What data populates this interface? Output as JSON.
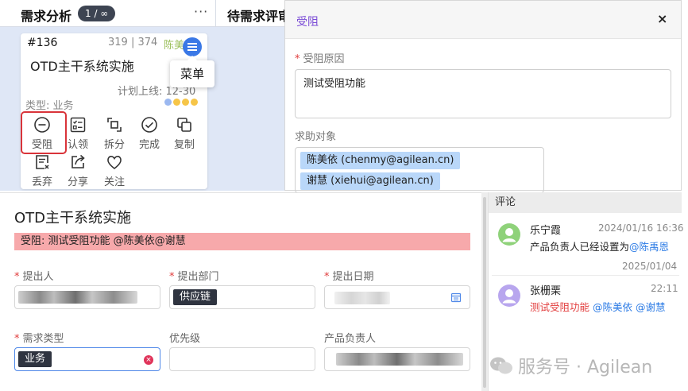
{
  "kanban": {
    "column1_title": "需求分析",
    "column1_count": "1 / ∞",
    "column2_title": "待需求评审",
    "card": {
      "id": "#136",
      "nums": "319 | 374",
      "owner": "陈美",
      "title": "OTD主干系统实施",
      "plan": "计划上线: 12-30",
      "type": "类型: 业务",
      "dot_colors": [
        "#9bb8f0",
        "#f6c548",
        "#f6c548",
        "#f6c548"
      ]
    },
    "menu_tooltip": "菜单",
    "actions": [
      {
        "label": "受阻",
        "icon": "minus-circle-icon"
      },
      {
        "label": "认领",
        "icon": "checklist-icon"
      },
      {
        "label": "拆分",
        "icon": "split-icon"
      },
      {
        "label": "完成",
        "icon": "check-circle-icon"
      },
      {
        "label": "复制",
        "icon": "copy-icon"
      },
      {
        "label": "丢弃",
        "icon": "discard-icon"
      },
      {
        "label": "分享",
        "icon": "share-icon"
      },
      {
        "label": "关注",
        "icon": "heart-icon"
      }
    ]
  },
  "dialog": {
    "title": "受阻",
    "close": "×",
    "reason_label": "受阻原因",
    "reason_value": "测试受阻功能",
    "helpers_label": "求助对象",
    "helpers": [
      "陈美依 (chenmy@agilean.cn)",
      "谢慧 (xiehui@agilean.cn)"
    ]
  },
  "detail": {
    "title": "OTD主干系统实施",
    "banner": "受阻: 测试受阻功能 @陈美依@谢慧",
    "fields": {
      "proposer_label": "提出人",
      "dept_label": "提出部门",
      "dept_value": "供应链",
      "date_label": "提出日期",
      "type_label": "需求类型",
      "type_value": "业务",
      "priority_label": "优先级",
      "owner_label": "产品负责人"
    }
  },
  "comments": {
    "header": "评论",
    "items": [
      {
        "name": "乐宁霞",
        "time": "2024/01/16 16:36",
        "text": "产品负责人已经设置为",
        "mention": "@陈禹恩",
        "avatar_color": "#8fd27a"
      },
      {
        "name": "张栅栗",
        "time": "22:11",
        "text": "测试受阻功能",
        "mention": "@陈美依 @谢慧",
        "avatar_color": "#b8a6ee"
      }
    ],
    "date_separator": "2025/01/04"
  },
  "watermark": "服务号 · Agilean"
}
